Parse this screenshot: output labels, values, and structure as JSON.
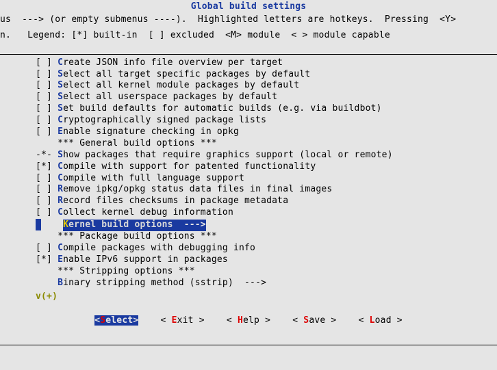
{
  "title": "Global build settings",
  "legend_line1_a": "us  ---> (or empty submenus ----).  Highlighted letters are hotkeys.  Pressing  ",
  "legend_line1_b": "<Y>",
  "legend_line2": "n.   Legend: [*] built-in  [ ] excluded  <M> module  < > module capable",
  "items": [
    {
      "prefix": "[ ] ",
      "hk": "C",
      "text": "reate JSON info file overview per target"
    },
    {
      "prefix": "[ ] ",
      "hk": "S",
      "text": "elect all target specific packages by default"
    },
    {
      "prefix": "[ ] ",
      "hk": "S",
      "text": "elect all kernel module packages by default"
    },
    {
      "prefix": "[ ] ",
      "hk": "S",
      "text": "elect all userspace packages by default"
    },
    {
      "prefix": "[ ] ",
      "hk": "S",
      "text": "et build defaults for automatic builds (e.g. via buildbot)"
    },
    {
      "prefix": "[ ] ",
      "hk": "C",
      "text": "ryptographically signed package lists"
    },
    {
      "prefix": "[ ] ",
      "hk": "E",
      "text": "nable signature checking in opkg"
    },
    {
      "prefix": "    ",
      "hk": "",
      "text": "*** General build options ***"
    },
    {
      "prefix": "-*- ",
      "hk": "S",
      "text": "how packages that require graphics support (local or remote)"
    },
    {
      "prefix": "[*] ",
      "hk": "C",
      "text": "ompile with support for patented functionality"
    },
    {
      "prefix": "[ ] ",
      "hk": "C",
      "text": "ompile with full language support"
    },
    {
      "prefix": "[ ] ",
      "hk": "R",
      "text": "emove ipkg/opkg status data files in final images"
    },
    {
      "prefix": "[ ] ",
      "hk": "R",
      "text": "ecord files checksums in package metadata"
    },
    {
      "prefix": "[ ] ",
      "hk": "C",
      "text": "ollect kernel debug information"
    }
  ],
  "highlighted": {
    "prefix": "    ",
    "hk": "K",
    "text": "ernel build options  ",
    "arrow": "--->"
  },
  "items2": [
    {
      "prefix": "    ",
      "hk": "",
      "text": "*** Package build options ***"
    },
    {
      "prefix": "[ ] ",
      "hk": "C",
      "text": "ompile packages with debugging info"
    },
    {
      "prefix": "[*] ",
      "hk": "E",
      "text": "nable IPv6 support in packages"
    },
    {
      "prefix": "    ",
      "hk": "",
      "text": "*** Stripping options ***"
    },
    {
      "prefix": "    ",
      "hk": "B",
      "text": "inary stripping method (sstrip)  --->"
    }
  ],
  "scroll_indicator": "v(+)",
  "buttons": {
    "select": {
      "open": "<",
      "hk": "S",
      "rest": "elect>"
    },
    "exit": {
      "open": "< ",
      "hk": "E",
      "rest": "xit >"
    },
    "help": {
      "open": "< ",
      "hk": "H",
      "rest": "elp >"
    },
    "save": {
      "open": "< ",
      "hk": "S",
      "rest": "ave >"
    },
    "load": {
      "open": "< ",
      "hk": "L",
      "rest": "oad >"
    }
  }
}
